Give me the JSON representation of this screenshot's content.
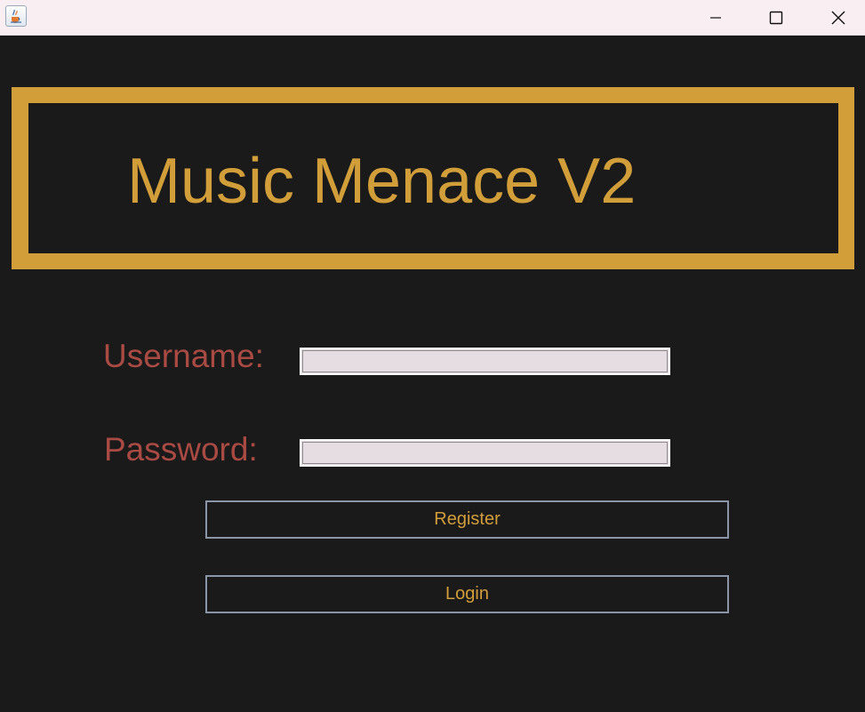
{
  "window": {
    "controls": {
      "minimize_icon": "minimize-icon",
      "maximize_icon": "maximize-icon",
      "close_icon": "close-icon"
    },
    "app_icon": "java-cup-icon"
  },
  "header": {
    "title": "Music Menace V2"
  },
  "form": {
    "username_label": "Username:",
    "username_value": "",
    "password_label": "Password:",
    "password_value": "",
    "register_label": "Register",
    "login_label": "Login"
  },
  "colors": {
    "background": "#1a1a1b",
    "accent_gold": "#d29e3a",
    "label_red": "#a94a43",
    "titlebar": "#f9eef2",
    "input_fill": "#e6dde2",
    "button_border": "#8a96a8"
  }
}
